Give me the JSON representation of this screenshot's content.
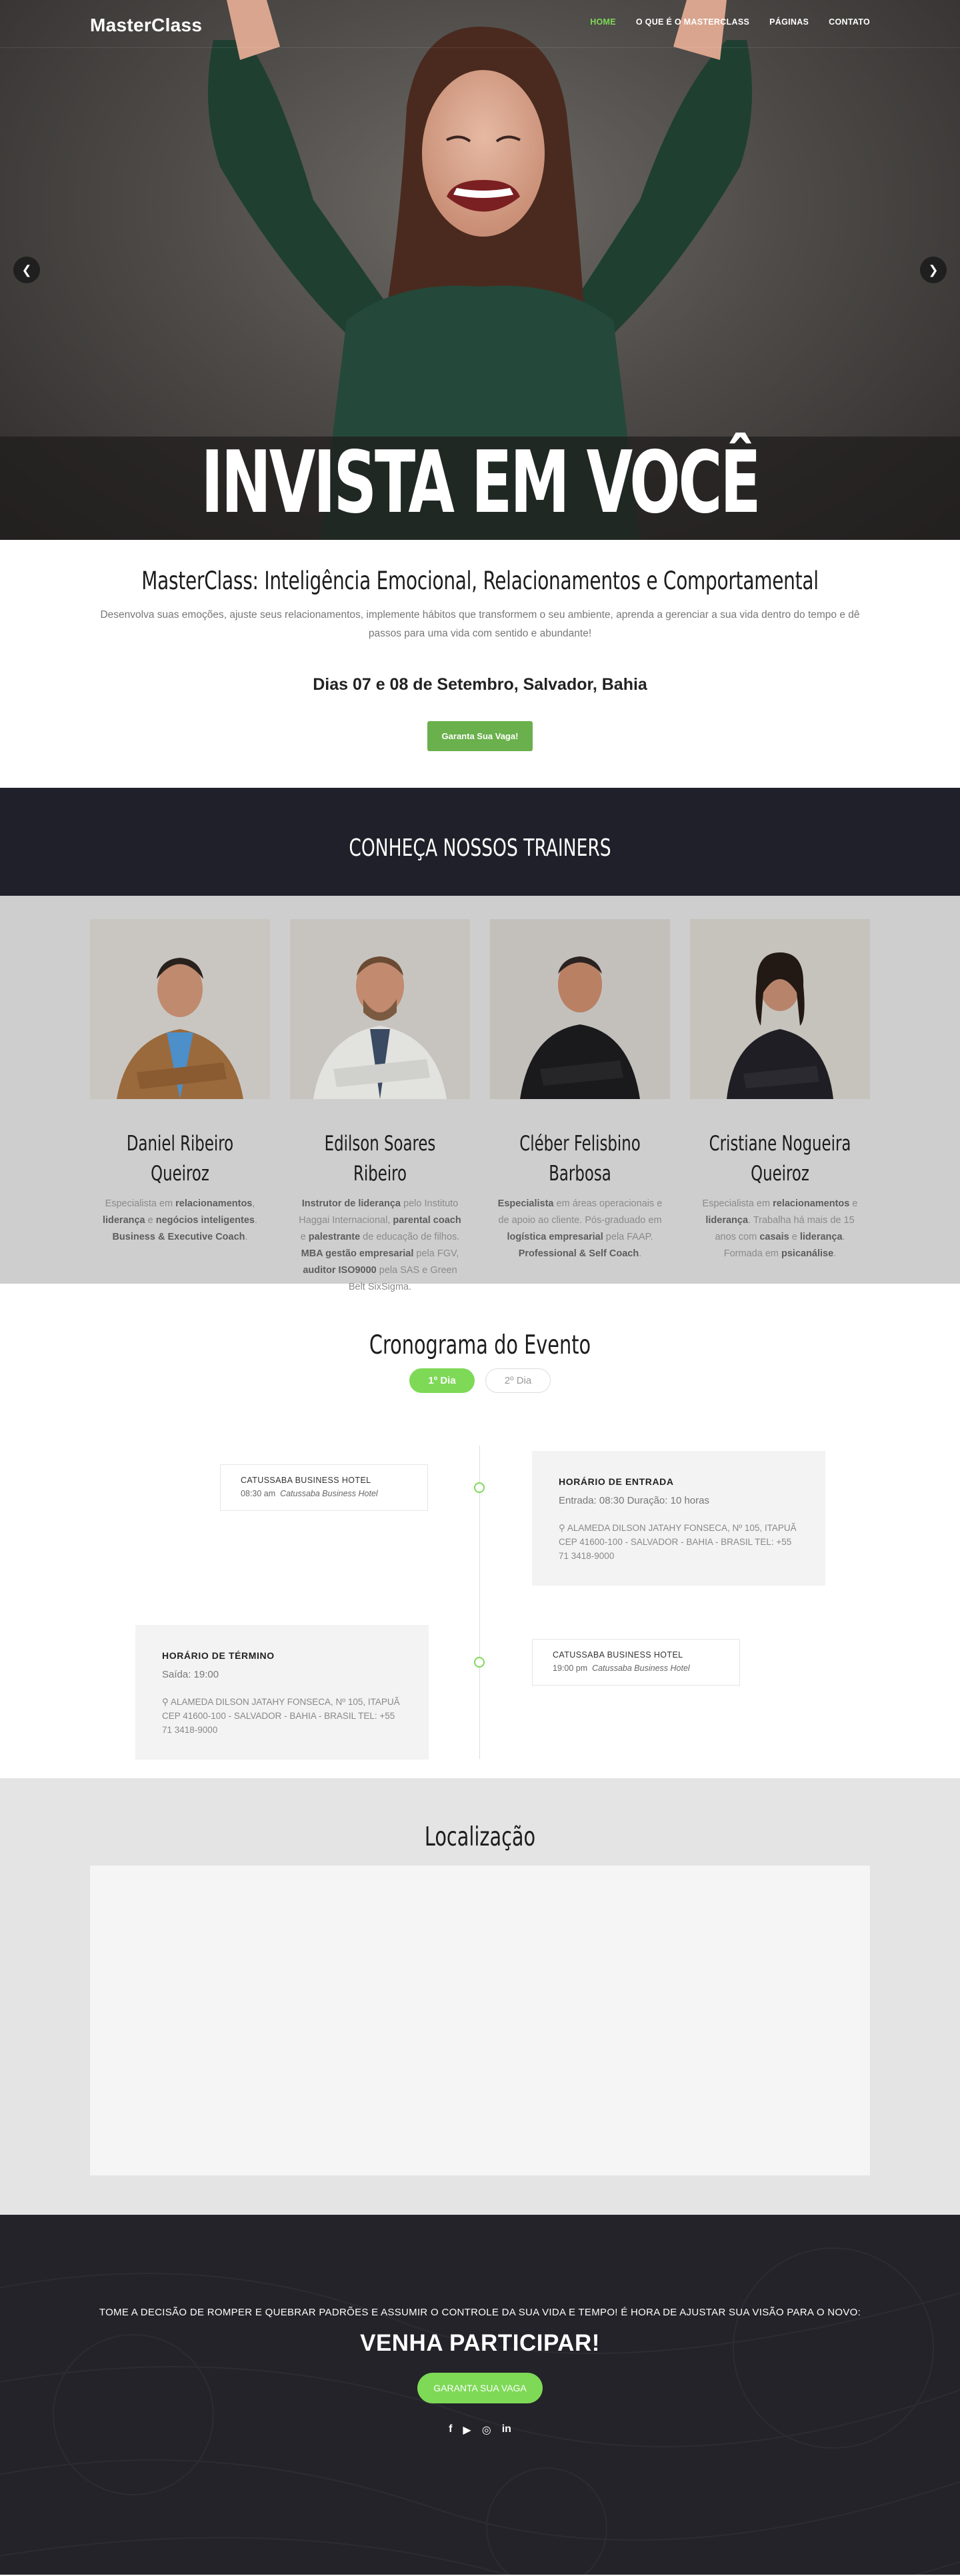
{
  "header": {
    "logo": "MasterClass",
    "menu": [
      "HOME",
      "O QUE É O MASTERCLASS",
      "PÁGINAS",
      "CONTATO"
    ]
  },
  "hero": {
    "title": "INVISTA EM VOCÊ",
    "prev_icon": "chevron-left-icon",
    "next_icon": "chevron-right-icon"
  },
  "intro": {
    "title": "MasterClass: Inteligência Emocional, Relacionamentos e Comportamental",
    "description": "Desenvolva suas emoções, ajuste seus relacionamentos, implemente hábitos que transformem o seu ambiente, aprenda a gerenciar a sua vida dentro do tempo e dê passos para uma vida com sentido e abundante!",
    "dates": "Dias 07 e 08 de Setembro, Salvador, Bahia",
    "button": "Garanta Sua Vaga!"
  },
  "trainers": {
    "heading": "CONHEÇA NOSSOS TRAINERS",
    "items": [
      {
        "name": "Daniel Ribeiro Queiroz",
        "parts": [
          "Especialista em ",
          "relacionamentos",
          ", ",
          "liderança",
          " e ",
          "negócios inteligentes",
          ". ",
          "Business & Executive Coach",
          "."
        ]
      },
      {
        "name": "Edilson Soares Ribeiro",
        "parts": [
          "",
          "Instrutor de liderança",
          " pelo Instituto Haggai Internacional, ",
          "parental coach",
          " e ",
          "palestrante",
          " de educação de filhos. ",
          "MBA gestão empresarial",
          " pela FGV, ",
          "auditor ISO9000",
          " pela SAS e Green Belt SixSigma."
        ]
      },
      {
        "name": "Cléber Felisbino Barbosa",
        "parts": [
          "",
          "Especialista",
          " em áreas operacionais e de apoio ao cliente. Pós-graduado em ",
          "logística empresarial",
          " pela FAAP. ",
          "Professional & Self Coach",
          "."
        ]
      },
      {
        "name": "Cristiane Nogueira Queiroz",
        "parts": [
          "Especialista em ",
          "relacionamentos",
          " e ",
          "liderança",
          ". Trabalha há mais de 15 anos com ",
          "casais",
          " e ",
          "liderança",
          ". Formada em ",
          "psicanálise",
          "."
        ]
      }
    ]
  },
  "schedule": {
    "title": "Cronograma do Evento",
    "tabs": [
      "1º Dia",
      "2º Dia"
    ],
    "active_tab": "1º Dia",
    "event1": {
      "venue": "CATUSSABA BUSINESS HOTEL",
      "time": "08:30 am",
      "place": "Catussaba Business Hotel"
    },
    "entry": {
      "title": "HORÁRIO DE ENTRADA",
      "sub": "Entrada: 08:30 Duração: 10 horas",
      "address": "ALAMEDA DILSON JATAHY FONSECA, Nº 105, ITAPUÃ CEP 41600-100 - SALVADOR - BAHIA - BRASIL TEL: +55 71 3418-9000"
    },
    "end": {
      "title": "HORÁRIO DE TÉRMINO",
      "sub": "Saída: 19:00",
      "address": "ALAMEDA DILSON JATAHY FONSECA, Nº 105, ITAPUÃ CEP 41600-100 - SALVADOR - BAHIA - BRASIL TEL: +55 71 3418-9000"
    },
    "event2": {
      "venue": "CATUSSABA BUSINESS HOTEL",
      "time": "19:00 pm",
      "place": "Catussaba Business Hotel"
    }
  },
  "location": {
    "title": "Localização"
  },
  "cta": {
    "line1": "TOME A DECISÃO DE ROMPER E QUEBRAR PADRÕES E ASSUMIR O CONTROLE DA SUA VIDA E TEMPO! É HORA DE AJUSTAR SUA VISÃO PARA O NOVO:",
    "line2": "VENHA PARTICIPAR!",
    "button": "GARANTA SUA VAGA",
    "social": [
      "facebook-icon",
      "youtube-icon",
      "instagram-icon",
      "linkedin-icon"
    ]
  },
  "colors": {
    "accent": "#7ed957",
    "button_green": "#6ab04c",
    "dark": "#20202a"
  }
}
